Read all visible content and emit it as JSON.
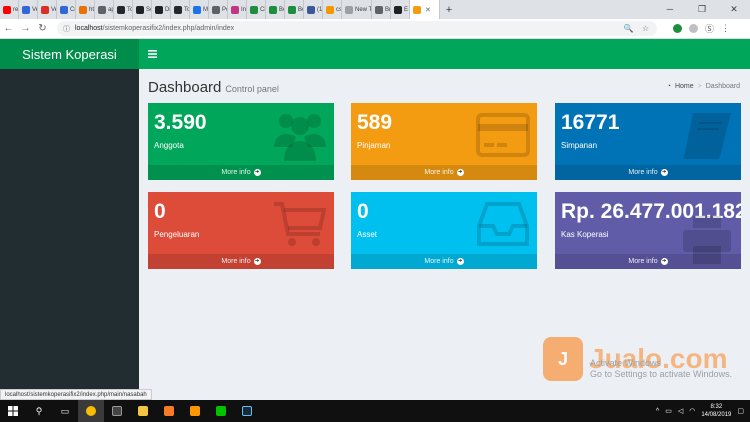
{
  "browser": {
    "tabs": [
      {
        "label": "re",
        "color": "#ff0000"
      },
      {
        "label": "Ve",
        "color": "#3367d6"
      },
      {
        "label": "Ve",
        "color": "#d93025"
      },
      {
        "label": "Cr",
        "color": "#3367d6"
      },
      {
        "label": "ht",
        "color": "#e8710a"
      },
      {
        "label": "ap",
        "color": "#5f6368"
      },
      {
        "label": "To",
        "color": "#24292e"
      },
      {
        "label": "Sc",
        "color": "#202124"
      },
      {
        "label": "Di",
        "color": "#202124"
      },
      {
        "label": "To",
        "color": "#24292e"
      },
      {
        "label": "M",
        "color": "#1a73e8"
      },
      {
        "label": "Pc",
        "color": "#5f6368"
      },
      {
        "label": "In",
        "color": "#c13584"
      },
      {
        "label": "Cl",
        "color": "#1e8e3e"
      },
      {
        "label": "Bc",
        "color": "#1e8e3e"
      },
      {
        "label": "Bc",
        "color": "#1e8e3e"
      },
      {
        "label": "(1",
        "color": "#3b5998"
      },
      {
        "label": "cs",
        "color": "#f29900"
      },
      {
        "label": "New T",
        "color": "#9aa0a6"
      },
      {
        "label": "Br",
        "color": "#5f6368"
      },
      {
        "label": "E",
        "color": "#202124"
      }
    ],
    "active_tab_label": "",
    "url_host": "localhost",
    "url_path": "/sistemkoperasifix2/index.php/admin/index",
    "status_url": "localhost/sistemkoperasifix2/index.php/main/nasabah"
  },
  "app": {
    "brand": "Sistem Koperasi",
    "page_title": "Dashboard",
    "page_subtitle": "Control panel",
    "breadcrumb_home": "Home",
    "breadcrumb_current": "Dashboard",
    "more_info": "More info"
  },
  "cards": [
    {
      "value": "3.590",
      "label": "Anggota",
      "icon": "users-icon",
      "color": "#00a65a"
    },
    {
      "value": "589",
      "label": "Pinjaman",
      "icon": "credit-card-icon",
      "color": "#f39c12"
    },
    {
      "value": "16771",
      "label": "Simpanan",
      "icon": "book-icon",
      "color": "#0073b7"
    },
    {
      "value": "0",
      "label": "Pengeluaran",
      "icon": "shopping-cart-icon",
      "color": "#dd4b39"
    },
    {
      "value": "0",
      "label": "Asset",
      "icon": "inbox-icon",
      "color": "#00c0ef"
    },
    {
      "value": "Rp. 26.477.001.182",
      "label": "Kas Koperasi",
      "icon": "print-icon",
      "color": "#605ca8"
    }
  ],
  "overlay": {
    "watermark": "Jualo.com",
    "activate_title": "Activate Windows",
    "activate_sub": "Go to Settings to activate Windows."
  },
  "taskbar": {
    "time": "8:32",
    "date": "14/08/2019"
  }
}
